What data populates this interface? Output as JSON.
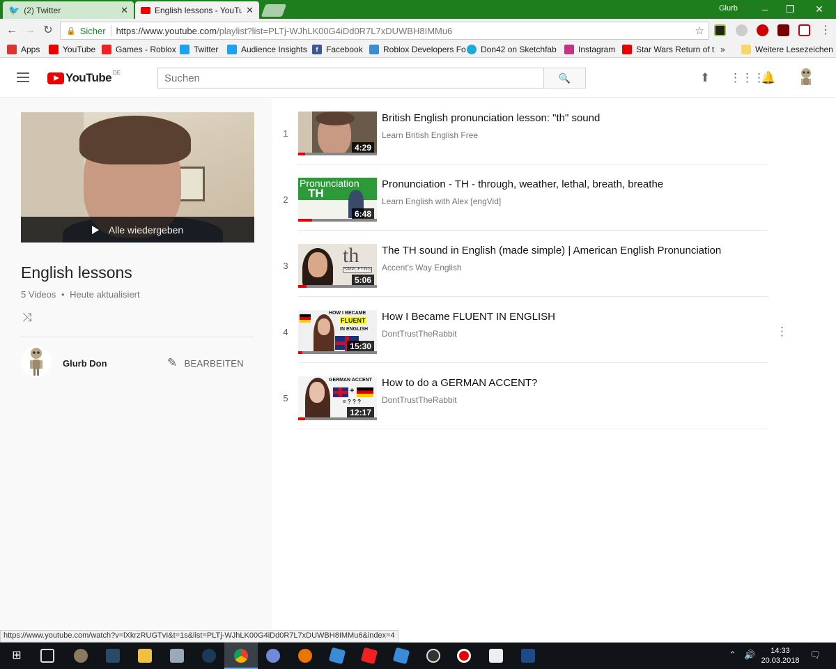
{
  "browser": {
    "tabs": [
      {
        "label": "(2) Twitter"
      },
      {
        "label": "English lessons - YouTube"
      }
    ],
    "window_user": "Glurb",
    "secure_label": "Sicher",
    "url_host": "https://www.youtube.com",
    "url_path": "/playlist?list=PLTj-WJhLK00G4iDd0R7L7xDUWBH8IMMu6",
    "bookmarks": [
      {
        "label": "Apps",
        "icon": "apps-grid-icon",
        "color": "#d33"
      },
      {
        "label": "YouTube",
        "icon": "youtube-icon",
        "color": "#e00"
      },
      {
        "label": "Games - Roblox",
        "icon": "roblox-icon",
        "color": "#e22"
      },
      {
        "label": "Twitter",
        "icon": "twitter-icon",
        "color": "#1da1f2"
      },
      {
        "label": "Audience Insights",
        "icon": "twitter-icon",
        "color": "#1da1f2"
      },
      {
        "label": "Facebook",
        "icon": "facebook-icon",
        "color": "#3b5998"
      },
      {
        "label": "Roblox Developers Fo",
        "icon": "roblox-dev-icon",
        "color": "#3a8cd8"
      },
      {
        "label": "Don42 on Sketchfab",
        "icon": "sketchfab-icon",
        "color": "#1caad9"
      },
      {
        "label": "Instagram",
        "icon": "instagram-icon",
        "color": "#c13584"
      },
      {
        "label": "Star Wars Return of t",
        "icon": "youtube-icon",
        "color": "#e00"
      }
    ],
    "bookmarks_more": "»",
    "bookmarks_other": "Weitere Lesezeichen",
    "status_url": "https://www.youtube.com/watch?v=lXkrzRUGTvI&t=1s&list=PLTj-WJhLK00G4iDd0R7L7xDUWBH8IMMu6&index=4"
  },
  "youtube": {
    "logo_text": "YouTube",
    "country_code": "DE",
    "search_placeholder": "Suchen"
  },
  "playlist": {
    "play_all_label": "Alle wiedergeben",
    "title": "English lessons",
    "video_count": "5 Videos",
    "meta_sep": "•",
    "updated": "Heute aktualisiert",
    "owner": "Glurb Don",
    "edit_label": "BEARBEITEN"
  },
  "videos": [
    {
      "index": "1",
      "title": "British English pronunciation lesson: \"th\" sound",
      "channel": "Learn British English Free",
      "duration": "4:29",
      "thumb": "#6a5a4a"
    },
    {
      "index": "2",
      "title": "Pronunciation - TH - through, weather, lethal, breath, breathe",
      "channel": "Learn English with Alex [engVid]",
      "duration": "6:48",
      "thumb": "#2d9a3a",
      "thumb_text_1": "Pronunciation",
      "thumb_text_2": "TH"
    },
    {
      "index": "3",
      "title": "The TH sound in English (made simple) | American English Pronunciation",
      "channel": "Accent's Way English",
      "duration": "5:06",
      "thumb": "#e8e4dc",
      "thumb_text_1": "th",
      "thumb_text_2": "SIMPLIFYING"
    },
    {
      "index": "4",
      "title": "How I Became FLUENT IN ENGLISH",
      "channel": "DontTrustTheRabbit",
      "duration": "15:30",
      "thumb": "#f0f0f0",
      "thumb_text_1": "HOW I BECAME",
      "thumb_text_2": "FLUENT",
      "thumb_text_3": "IN ENGLISH"
    },
    {
      "index": "5",
      "title": "How to do a GERMAN ACCENT?",
      "channel": "DontTrustTheRabbit",
      "duration": "12:17",
      "thumb": "#f4f4f4",
      "thumb_text_1": "GERMAN ACCENT",
      "thumb_text_2": "= ? ? ?"
    }
  ],
  "taskbar": {
    "time": "14:33",
    "date": "20.03.2018"
  },
  "colors": {
    "titlebar": "#1e7e1e",
    "yt_red": "#e00",
    "taskbar": "#101418"
  }
}
